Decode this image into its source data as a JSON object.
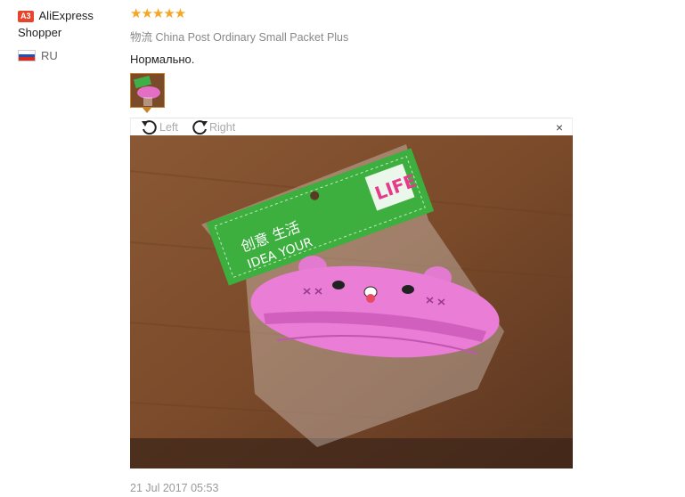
{
  "reviewer": {
    "badge": "A3",
    "name_first": "AliExpress",
    "name_second": "Shopper",
    "country_code": "RU"
  },
  "review": {
    "stars": "★★★★★",
    "rating": 5,
    "shipping_cn": "物流",
    "shipping_method": "China Post Ordinary Small Packet Plus",
    "text": "Нормально.",
    "date": "21 Jul 2017 05:53"
  },
  "viewer": {
    "rotate_left_label": "Left",
    "rotate_right_label": "Right",
    "close_glyph": "×"
  },
  "photo": {
    "package_brand_text": "创意 生活",
    "package_slogan": "IDEA YOUR",
    "package_logo": "LIFE"
  },
  "colors": {
    "star": "#f5a623",
    "badge": "#e8432b",
    "thumb_border": "#c8812c",
    "muted_text": "#999999"
  }
}
